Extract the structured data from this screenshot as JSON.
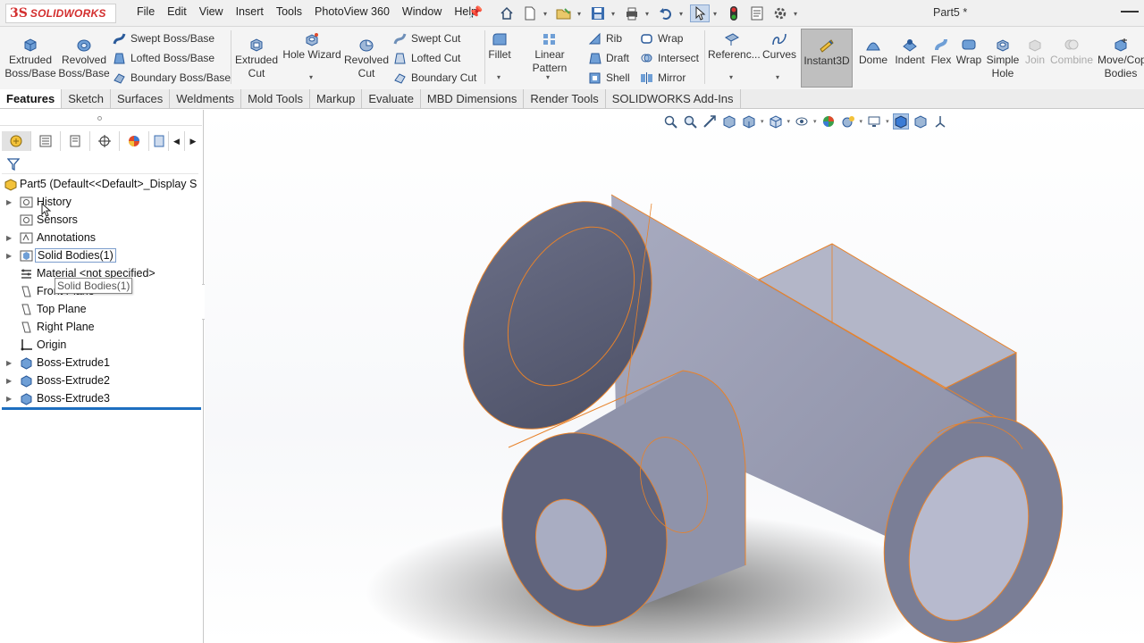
{
  "app": {
    "logo_ds": "3S",
    "logo_brand": "SOLIDWORKS",
    "doc_title": "Part5 *"
  },
  "menu": [
    "File",
    "Edit",
    "View",
    "Insert",
    "Tools",
    "PhotoView 360",
    "Window",
    "Help"
  ],
  "quick_access_icons": [
    "home-icon",
    "new-document-icon",
    "open-icon",
    "save-icon",
    "print-icon",
    "undo-icon",
    "select-icon",
    "rebuild-icon",
    "file-properties-icon",
    "options-icon"
  ],
  "commands": {
    "extruded_boss": "Extruded Boss/Base",
    "revolved_boss": "Revolved Boss/Base",
    "swept_boss": "Swept Boss/Base",
    "lofted_boss": "Lofted Boss/Base",
    "boundary_boss": "Boundary Boss/Base",
    "extruded_cut": "Extruded Cut",
    "hole_wizard": "Hole Wizard",
    "revolved_cut": "Revolved Cut",
    "swept_cut": "Swept Cut",
    "lofted_cut": "Lofted Cut",
    "boundary_cut": "Boundary Cut",
    "fillet": "Fillet",
    "linear_pattern": "Linear Pattern",
    "rib": "Rib",
    "draft": "Draft",
    "shell": "Shell",
    "wrap": "Wrap",
    "intersect": "Intersect",
    "mirror": "Mirror",
    "reference": "Referenc...",
    "curves": "Curves",
    "instant3d": "Instant3D",
    "dome": "Dome",
    "indent": "Indent",
    "flex": "Flex",
    "wrap2": "Wrap",
    "simple_hole": "Simple Hole",
    "join": "Join",
    "combine": "Combine",
    "move_copy": "Move/Cop Bodies"
  },
  "tabs": [
    "Features",
    "Sketch",
    "Surfaces",
    "Weldments",
    "Mold Tools",
    "Markup",
    "Evaluate",
    "MBD Dimensions",
    "Render Tools",
    "SOLIDWORKS Add-Ins"
  ],
  "tree": {
    "root": "Part5  (Default<<Default>_Display S",
    "items": [
      "History",
      "Sensors",
      "Annotations",
      "Solid Bodies(1)",
      "Material <not specified>",
      "Front Plane",
      "Top Plane",
      "Right Plane",
      "Origin",
      "Boss-Extrude1",
      "Boss-Extrude2",
      "Boss-Extrude3"
    ],
    "tooltip": "Solid Bodies(1)"
  },
  "colors": {
    "accent": "#1e6fc0",
    "brand": "#d32f2f",
    "model_face": "#8c90a8",
    "model_edge": "#e8822a"
  }
}
